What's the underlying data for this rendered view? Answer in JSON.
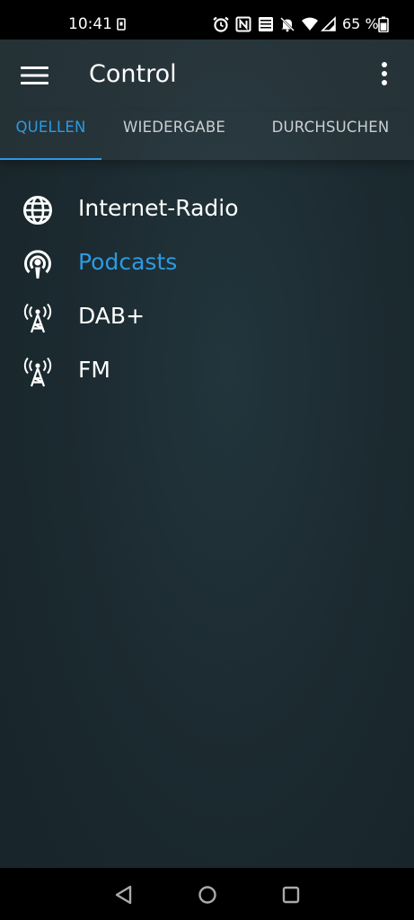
{
  "status_bar": {
    "time": "10:41",
    "battery_text": "65 %",
    "icons": [
      "screenshot-indicator-icon",
      "alarm-icon",
      "nfc-icon",
      "volte-icon",
      "mute-icon",
      "wifi-icon",
      "signal-icon",
      "battery-icon"
    ]
  },
  "app_bar": {
    "title": "Control",
    "menu_icon": "hamburger-menu-icon",
    "overflow_icon": "more-vert-icon"
  },
  "tabs": [
    {
      "label": "QUELLEN",
      "active": true
    },
    {
      "label": "WIEDERGABE",
      "active": false
    },
    {
      "label": "DURCHSUCHEN",
      "active": false
    }
  ],
  "sources": [
    {
      "label": "Internet-Radio",
      "icon": "globe-icon",
      "selected": false
    },
    {
      "label": "Podcasts",
      "icon": "podcast-icon",
      "selected": true
    },
    {
      "label": "DAB+",
      "icon": "radio-tower-icon",
      "selected": false
    },
    {
      "label": "FM",
      "icon": "radio-tower-icon",
      "selected": false
    }
  ],
  "nav_bar": {
    "icons": [
      "back-icon",
      "home-icon",
      "recents-icon"
    ]
  },
  "colors": {
    "accent": "#2d9ae0",
    "background": "#1c2b31",
    "text": "#ffffff",
    "tab_inactive": "#c9cfd2"
  }
}
